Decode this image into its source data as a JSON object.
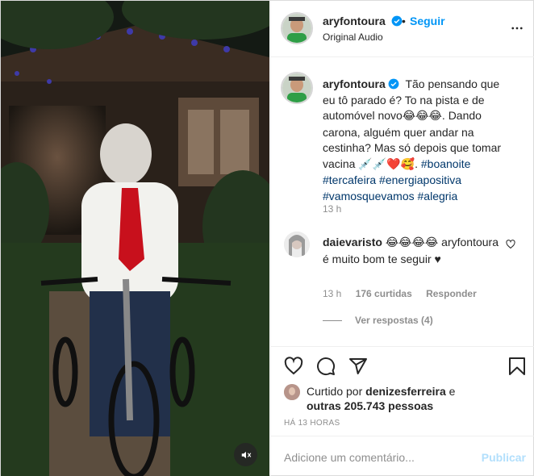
{
  "header": {
    "username": "aryfontoura",
    "separator": "•",
    "follow_label": "Seguir",
    "audio_label": "Original Audio"
  },
  "caption": {
    "username": "aryfontoura",
    "text_1": "Tão pensando que eu tô parado é? To na pista e de automóvel novo",
    "emoji_1": "😂😂😂",
    "text_2": ". Dando carona, alguém quer andar na cestinha? Mas só depois que tomar vacina ",
    "emoji_2": "💉💉❤️🥰",
    "text_3": ". ",
    "hashtags": [
      "#boanoite",
      "#tercafeira",
      "#energiapositiva",
      "#vamosquevamos",
      "#alegria"
    ],
    "time": "13 h"
  },
  "comment": {
    "username": "daievaristo",
    "emoji": "😂😂😂😂",
    "text": "aryfontoura é muito bom te seguir ♥",
    "time": "13 h",
    "likes": "176 curtidas",
    "reply_label": "Responder",
    "view_replies": "Ver respostas (4)"
  },
  "likes": {
    "prefix": "Curtido por ",
    "user": "denizesferreira",
    "middle": " e ",
    "others": "outras 205.743 pessoas"
  },
  "posted_ago": "HÁ 13 HORAS",
  "add_comment": {
    "placeholder": "Adicione um comentário...",
    "publish_label": "Publicar"
  },
  "icons": {
    "verified": "verified-badge-icon",
    "more": "more-options-icon",
    "like": "heart-icon",
    "comment": "comment-icon",
    "share": "share-icon",
    "save": "bookmark-icon",
    "mute": "muted-speaker-icon"
  },
  "colors": {
    "accent": "#0095f6",
    "hashtag": "#00376b",
    "muted": "#8e8e8e",
    "publish_disabled": "#b2dffc"
  }
}
